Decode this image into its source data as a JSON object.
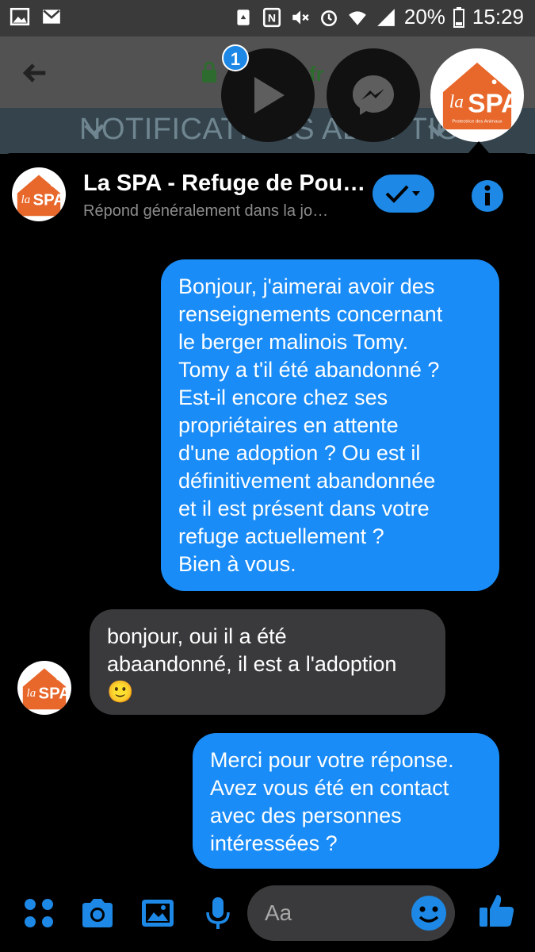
{
  "status_bar": {
    "battery": "20%",
    "time": "15:29"
  },
  "browser": {
    "url_fragment": "fr"
  },
  "page": {
    "banner_title": "NOTIFICATIONS ADOPTION"
  },
  "chat_heads": {
    "badge_count": "1"
  },
  "chat_header": {
    "title": "La SPA - Refuge de Pou…",
    "subtitle": "Répond généralement dans la jo…"
  },
  "messages": [
    {
      "direction": "outgoing",
      "lines": [
        "Bonjour, j'aimerai avoir des",
        "renseignements concernant",
        "le berger malinois Tomy.",
        "Tomy a t'il été abandonné ?",
        "Est-il encore chez ses",
        "propriétaires en attente",
        "d'une adoption ? Ou est il",
        "définitivement abandonnée",
        "et il est présent dans votre",
        "refuge actuellement ?",
        "Bien à vous."
      ]
    },
    {
      "direction": "incoming",
      "lines": [
        "bonjour, oui il a été",
        "abaandonné, il est a l'adoption",
        "🙂"
      ]
    },
    {
      "direction": "outgoing",
      "lines": [
        "Merci pour votre réponse.",
        "Avez vous été en contact",
        "avec des personnes",
        "intéressées ?"
      ]
    }
  ],
  "composer": {
    "placeholder": "Aa"
  },
  "logo": {
    "text_la": "la",
    "text_spa": "SPA",
    "tagline": "Protectrice des Animaux"
  },
  "colors": {
    "accent": "#1a8cf7",
    "incoming_bubble": "#3a3a3c",
    "logo_orange": "#e8672a"
  },
  "icons": [
    "image-icon",
    "gmail-icon",
    "recycle-icon",
    "nfc-icon",
    "mute-icon",
    "alarm-icon",
    "wifi-icon",
    "signal-icon",
    "battery-icon",
    "back-arrow-icon",
    "lock-icon",
    "play-icon",
    "messenger-icon",
    "check-icon",
    "info-icon",
    "apps-icon",
    "camera-icon",
    "gallery-icon",
    "microphone-icon",
    "emoji-icon",
    "like-icon"
  ]
}
